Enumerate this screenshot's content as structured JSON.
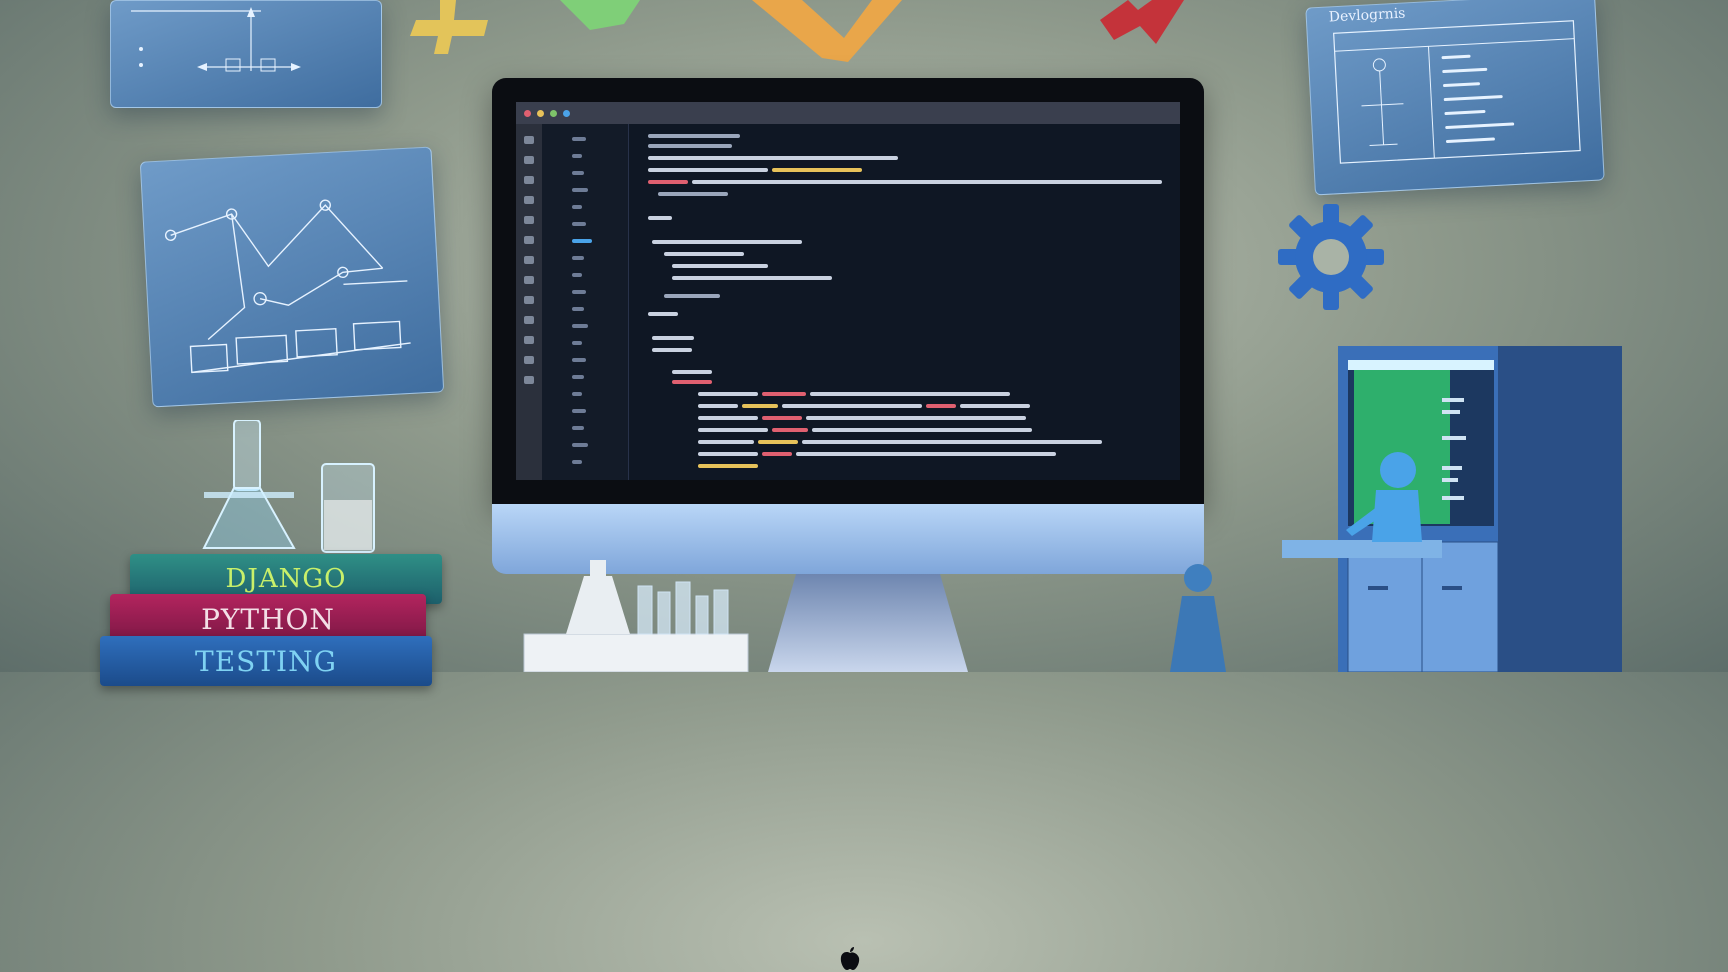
{
  "floating_panels": {
    "diagram_panel_title": "Devlogrnis"
  },
  "books": {
    "top": "DJANGO",
    "middle": "PYTHON",
    "bottom": "TESTING"
  },
  "colors": {
    "background": "#8f9a8c",
    "screen": "#0f1724",
    "panel_blue": "#4f7fb3",
    "gear": "#2f6cc4",
    "book_django": "#2f8f86",
    "book_python": "#b3245e",
    "book_testing": "#2f6fbd",
    "cabinet_green": "#31c46f"
  },
  "icons": [
    "gear-icon",
    "apple-logo-icon",
    "plus-icon",
    "lab-flask-icon",
    "beaker-icon",
    "robot-figure-icon"
  ]
}
